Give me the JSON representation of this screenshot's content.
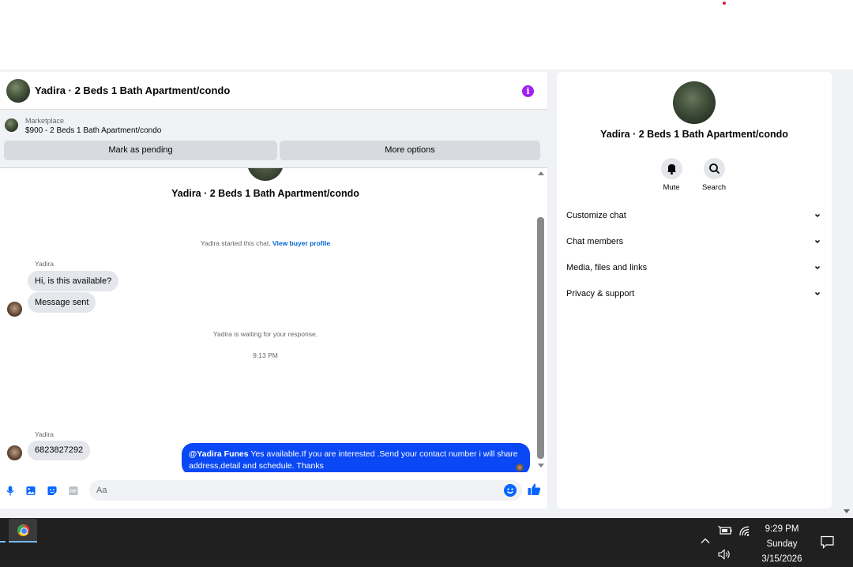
{
  "chat": {
    "title": "Yadira · 2 Beds 1 Bath Apartment/condo",
    "marketplace": {
      "label": "Marketplace",
      "listing": "$900 - 2 Beds 1 Bath Apartment/condo",
      "pending_button": "Mark as pending",
      "more_button": "More options"
    },
    "intro_name": "Yadira · 2 Beds 1 Bath Apartment/condo",
    "started_text": "Yadira started this chat.",
    "buyer_profile_link": "View buyer profile",
    "messages": [
      {
        "sender": "Yadira",
        "text": "Hi, is this available?"
      },
      {
        "text": "Message sent"
      }
    ],
    "waiting_text": "Yadira is waiting for your response.",
    "timestamp": "9:13 PM",
    "outgoing": {
      "mention": "@Yadira Funes",
      "text": " Yes available.If you are interested .Send your contact number i will share address,detail and schedule. Thanks"
    },
    "reply": {
      "sender": "Yadira",
      "text": "6823827292"
    },
    "composer_placeholder": "Aa"
  },
  "info": {
    "name": "Yadira · 2 Beds 1 Bath Apartment/condo",
    "actions": [
      {
        "label": "Mute",
        "icon": "bell-icon"
      },
      {
        "label": "Search",
        "icon": "search-icon"
      }
    ],
    "sections": [
      "Customize chat",
      "Chat members",
      "Media, files and links",
      "Privacy & support"
    ]
  },
  "taskbar": {
    "time": "9:29 PM",
    "day": "Sunday",
    "date": "3/15/2026"
  },
  "colors": {
    "accent": "#0866ff",
    "outgoing_bubble": "#0a48f5",
    "info_icon": "#a020f0"
  }
}
